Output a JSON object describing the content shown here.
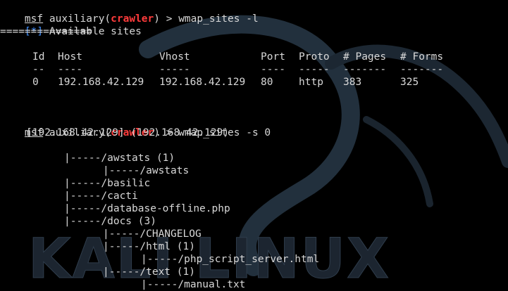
{
  "theme": {
    "background": "#000000",
    "text": "#d8d8d8",
    "module_color": "#ff3b3b",
    "info_color": "#3f8fff",
    "watermark_color": "#1c2530"
  },
  "watermark": {
    "text": "KALI LINUX"
  },
  "prompt": {
    "msf": "msf",
    "aux_prefix": " auxiliary(",
    "module": "crawler",
    "aux_suffix": ") > "
  },
  "commands": {
    "list": "wmap_sites -l",
    "show": "wmap_sites -s 0"
  },
  "sites": {
    "marker": "[*]",
    "title": " Available sites",
    "separator": "===============",
    "columns": [
      "Id",
      "Host",
      "Vhost",
      "Port",
      "Proto",
      "# Pages",
      "# Forms"
    ],
    "underlines": [
      "--",
      "----",
      "-----",
      "----",
      "-----",
      "-------",
      "-------"
    ],
    "rows": [
      [
        "0",
        "192.168.42.129",
        "192.168.42.129",
        "80",
        "http",
        "383",
        "325"
      ]
    ]
  },
  "tree": {
    "header": "[192.168.42.129] (192.168.42.129)",
    "lines": [
      "|-----/awstats (1)",
      "|-----/awstats",
      "|-----/basilic",
      "|-----/cacti",
      "|-----/database-offline.php",
      "|-----/docs (3)",
      "|-----/CHANGELOG",
      "|-----/html (1)",
      "|-----/php_script_server.html",
      "|-----/text (1)",
      "|-----/manual.txt"
    ]
  }
}
